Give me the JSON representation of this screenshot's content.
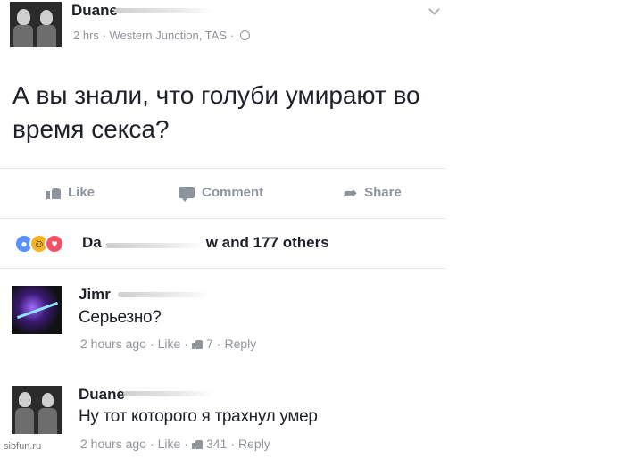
{
  "post": {
    "author": "Duane",
    "time": "2 hrs",
    "location": "Western Junction, TAS",
    "separator": "·",
    "text": "А вы знали, что голуби умирают во время секса?"
  },
  "actions": {
    "like": "Like",
    "comment": "Comment",
    "share": "Share"
  },
  "reactions": {
    "prefix": "Da",
    "suffix": "w and 177 others"
  },
  "comments": [
    {
      "author": "Jimr",
      "text": "Серьезно?",
      "time": "2 hours ago",
      "like": "Like",
      "likes": "7",
      "reply": "Reply"
    },
    {
      "author": "Duane",
      "text": "Ну тот которого я трахнул умер",
      "time": "2 hours ago",
      "like": "Like",
      "likes": "341",
      "reply": "Reply"
    }
  ],
  "watermark": "sibfun.ru",
  "colors": {
    "text": "#1d2129",
    "muted": "#90949c",
    "like": "#5890ff",
    "haha": "#f7b125",
    "love": "#f25268"
  }
}
